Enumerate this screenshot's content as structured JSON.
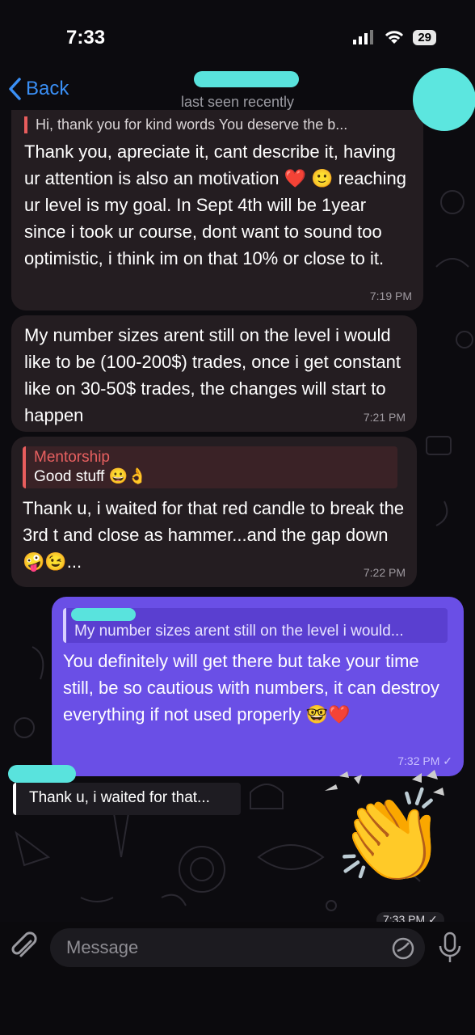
{
  "status": {
    "time": "7:33",
    "battery": "29"
  },
  "header": {
    "back_label": "Back",
    "subtitle": "last seen recently"
  },
  "messages": [
    {
      "reply_preview": "Hi, thank you for kind words You deserve the b...",
      "text": "Thank you, apreciate it, cant describe it, having ur attention is also an motivation ❤️ 🙂 reaching ur level is my goal. In Sept 4th will be 1year since i took ur course, dont want to sound too optimistic, i think im on that 10% or close to it.",
      "time": "7:19 PM"
    },
    {
      "text": "My number sizes arent still on the level i would like to be (100-200$) trades, once i get constant like on 30-50$ trades, the changes will start to happen",
      "time": "7:21 PM"
    },
    {
      "quote_title": "Mentorship",
      "quote_text": "Good stuff 😀👌",
      "text": "Thank u, i waited for that red candle to break the 3rd t and close as hammer...and the gap down 🤪😉...",
      "time": "7:22 PM"
    },
    {
      "quote_text": "My number sizes arent still on the level i would...",
      "text": "You definitely will get there but take your time still, be so cautious with numbers, it can destroy everything if not used properly 🤓❤️",
      "time": "7:32 PM ✓"
    },
    {
      "quote_text": "Thank u, i waited for that...",
      "emoji": "👏",
      "time": "7:33 PM ✓"
    }
  ],
  "input": {
    "placeholder": "Message"
  },
  "colors": {
    "accent": "#3a8ff5",
    "outgoing": "#6a4fe6",
    "incoming": "#241d21",
    "scribble": "#59e3dd"
  }
}
